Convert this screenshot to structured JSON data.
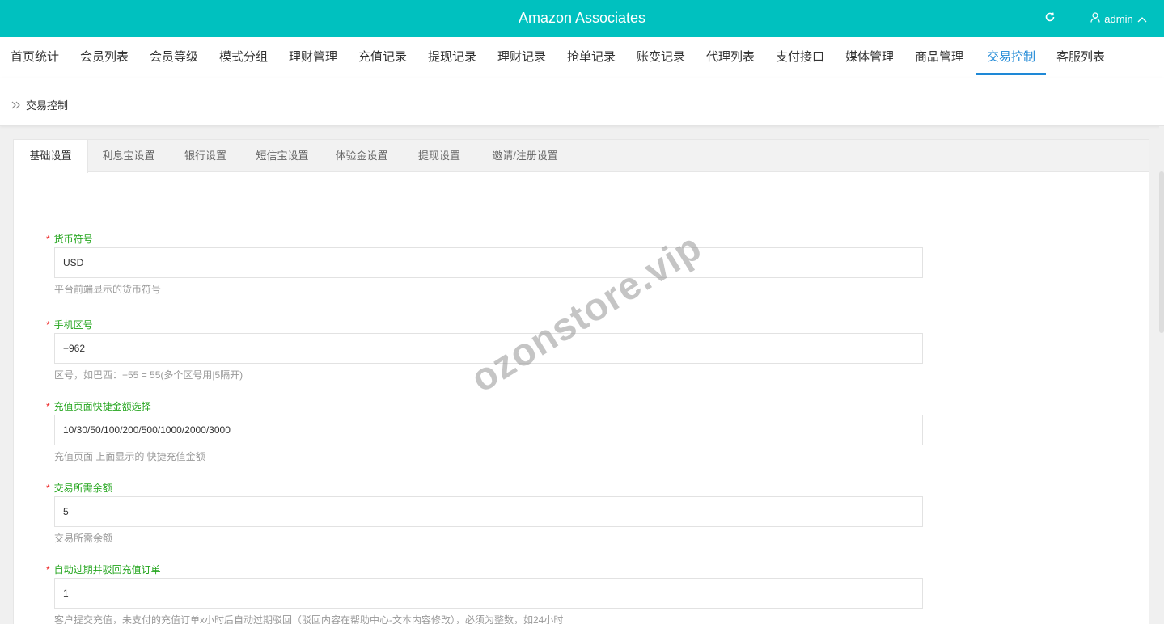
{
  "app": {
    "title": "Amazon Associates",
    "user": "admin"
  },
  "nav": {
    "items": [
      {
        "label": "首页统计",
        "active": false
      },
      {
        "label": "会员列表",
        "active": false
      },
      {
        "label": "会员等级",
        "active": false
      },
      {
        "label": "模式分组",
        "active": false
      },
      {
        "label": "理财管理",
        "active": false
      },
      {
        "label": "充值记录",
        "active": false
      },
      {
        "label": "提现记录",
        "active": false
      },
      {
        "label": "理财记录",
        "active": false
      },
      {
        "label": "抢单记录",
        "active": false
      },
      {
        "label": "账变记录",
        "active": false
      },
      {
        "label": "代理列表",
        "active": false
      },
      {
        "label": "支付接口",
        "active": false
      },
      {
        "label": "媒体管理",
        "active": false
      },
      {
        "label": "商品管理",
        "active": false
      },
      {
        "label": "交易控制",
        "active": true
      },
      {
        "label": "客服列表",
        "active": false
      }
    ]
  },
  "breadcrumb": {
    "text": "交易控制"
  },
  "tabs": [
    {
      "label": "基础设置",
      "active": true
    },
    {
      "label": "利息宝设置",
      "active": false
    },
    {
      "label": "银行设置",
      "active": false
    },
    {
      "label": "短信宝设置",
      "active": false
    },
    {
      "label": "体验金设置",
      "active": false
    },
    {
      "label": "提现设置",
      "active": false
    },
    {
      "label": "邀请/注册设置",
      "active": false
    }
  ],
  "form": {
    "required_mark": "*",
    "fields": [
      {
        "label": "货币符号",
        "value": "USD",
        "hint": "平台前端显示的货币符号"
      },
      {
        "label": "手机区号",
        "value": "+962",
        "hint": "区号，如巴西：+55 = 55(多个区号用|5隔开)"
      },
      {
        "label": "充值页面快捷金额选择",
        "value": "10/30/50/100/200/500/1000/2000/3000",
        "hint": "充值页面 上面显示的 快捷充值金额"
      },
      {
        "label": "交易所需余额",
        "value": "5",
        "hint": "交易所需余额"
      },
      {
        "label": "自动过期并驳回充值订单",
        "value": "1",
        "hint": "客户提交充值，未支付的充值订单x小时后自动过期驳回（驳回内容在帮助中心-文本内容修改），必须为整数，如24小时"
      }
    ]
  },
  "watermark": "ozonstore.vip",
  "colors": {
    "header": "#00c1bf",
    "active_nav": "#1e88d6",
    "label": "#23a51d",
    "required": "#ee2222"
  }
}
